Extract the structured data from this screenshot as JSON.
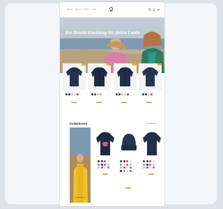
{
  "window": {
    "title": ""
  },
  "nav": {
    "links": [
      "Herren",
      "Damen",
      "Kinder",
      "Sale"
    ],
    "right_links": [
      "Suche",
      "Konto",
      "Warenkorb"
    ]
  },
  "hero": {
    "title": "Ein Druck-Kleidung für deine Leute"
  },
  "products": [
    {
      "name": "Unisex Hoodie",
      "colors": [
        "#2b3a5a",
        "#2b2f38",
        "#f0f0f0",
        "#cfd3da",
        "#d43a6a"
      ]
    },
    {
      "name": "Herren Jacke",
      "colors": [
        "#1f2a44",
        "#3b3f4a",
        "#f0f0f0",
        "#a9b3c2"
      ]
    },
    {
      "name": "Damen Jacke",
      "colors": [
        "#243252",
        "#34373f",
        "#e8e8e8",
        "#c9ced6",
        "#c83a5c"
      ]
    },
    {
      "name": "Kinder Hoodie",
      "colors": [
        "#2a3650",
        "#2f333c",
        "#f2f2f2",
        "#cf3b67"
      ]
    }
  ],
  "section": {
    "title": "Kollektionen",
    "link": "Alle ansehen"
  },
  "promo": {
    "button": "Entdecken"
  },
  "grid_items": [
    {
      "colors": [
        "#2b3a5a",
        "#243050",
        "#d23a6a",
        "#e0e0e0",
        "#7b8fa8",
        "#1d1d2a",
        "#cf4f7f",
        "#b0b8c4",
        "#e6a4c0",
        "#c33a66",
        "#d8d8d8",
        "#6f7f96"
      ]
    },
    {
      "colors": [
        "#2b3a5a",
        "#1d2436",
        "#d23a6a",
        "#e0e0e0",
        "#7b8fa8",
        "#c9ced6",
        "#cf4f7f",
        "#b0b8c4",
        "#e6a4c0",
        "#c33a66",
        "#d8d8d8",
        "#6f7f96",
        "#2a2a32",
        "#8f9ab0",
        "#e0e4ea",
        "#d05080"
      ]
    },
    {
      "colors": [
        "#2b3a5a",
        "#243050",
        "#d23a6a",
        "#e0e0e0",
        "#7b8fa8",
        "#1d1d2a",
        "#cf4f7f",
        "#b0b8c4",
        "#e6a4c0",
        "#c33a66",
        "#d8d8d8",
        "#6f7f96"
      ]
    }
  ]
}
